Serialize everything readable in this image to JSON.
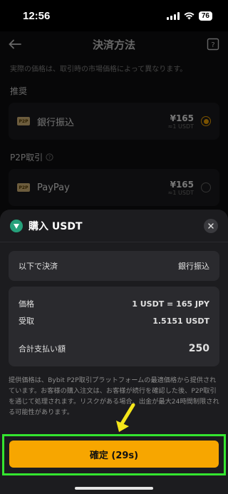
{
  "status_bar": {
    "time": "12:56",
    "battery": "76"
  },
  "background_page": {
    "nav_title": "決済方法",
    "note": "実際の価格は、取引時の市場価格によって異なります。",
    "section_recommended": "推奨",
    "section_p2p": "P2P取引",
    "methods": [
      {
        "icon_text": "P2P",
        "label": "銀行振込",
        "price": "¥165",
        "sub": "≈1 USDT",
        "selected": true
      },
      {
        "icon_text": "P2P",
        "label": "PayPay",
        "price": "¥165",
        "sub": "≈1 USDT",
        "selected": false
      }
    ]
  },
  "sheet": {
    "title": "購入 USDT",
    "pay_method_label": "以下で決済",
    "pay_method_value": "銀行振込",
    "price_label": "価格",
    "price_value": "1 USDT = 165 JPY",
    "receive_label": "受取",
    "receive_value": "1.5151 USDT",
    "total_label": "合計支払い額",
    "total_value": "250",
    "disclaimer": "提供価格は、Bybit P2P取引プラットフォームの最適価格から提供されています。お客様の購入注文は、お客様が続行を確認した後、P2P取引を通じて処理されます。リスクがある場合、出金が最大24時間制限される可能性があります。",
    "confirm_label": "確定 (29s)"
  },
  "colors": {
    "accent": "#f7a600",
    "highlight": "#34e52f",
    "annotation_arrow": "#f5e61a"
  }
}
